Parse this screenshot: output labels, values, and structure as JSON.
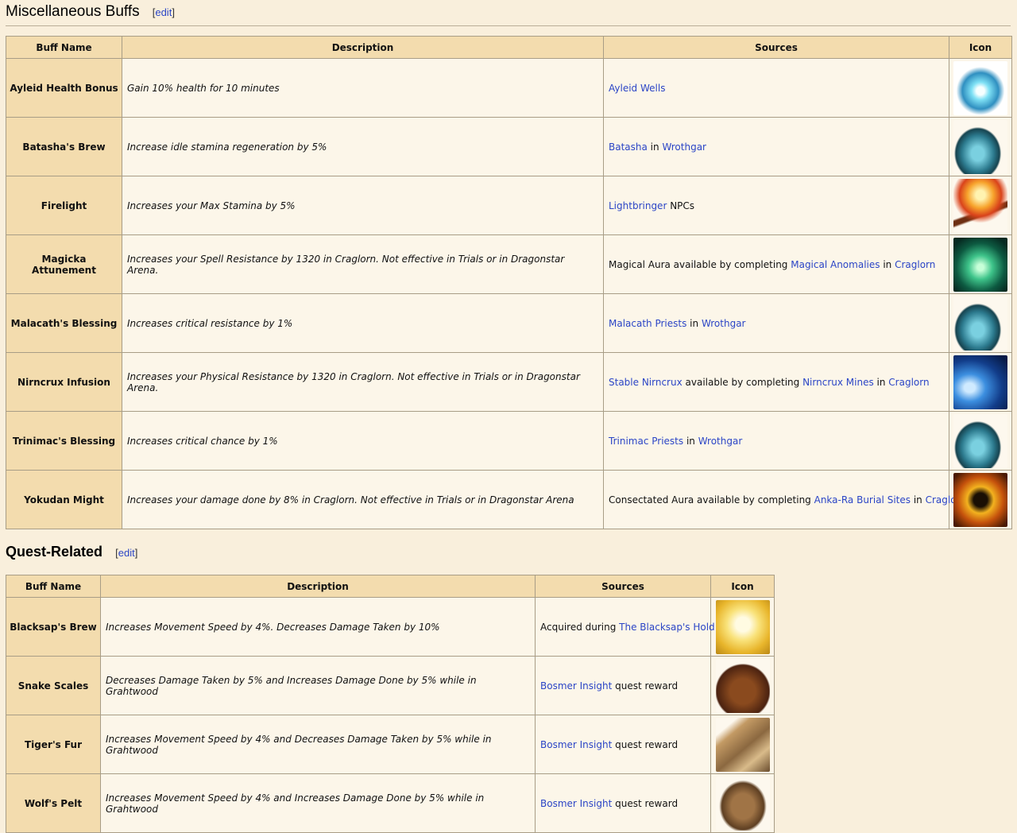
{
  "misc": {
    "title": "Miscellaneous Buffs",
    "edit": "edit",
    "headers": [
      "Buff Name",
      "Description",
      "Sources",
      "Icon"
    ],
    "rows": [
      {
        "name": "Ayleid Health Bonus",
        "desc": "Gain 10% health for 10 minutes",
        "sources": [
          {
            "text": "Ayleid Wells",
            "link": true
          }
        ],
        "icon": "blue-orb-icon"
      },
      {
        "name": "Batasha's Brew",
        "desc": "Increase idle stamina regeneration by 5%",
        "sources": [
          {
            "text": "Batasha",
            "link": true
          },
          {
            "text": " in ",
            "link": false
          },
          {
            "text": "Wrothgar",
            "link": true
          }
        ],
        "icon": "potion-jug-icon"
      },
      {
        "name": "Firelight",
        "desc": "Increases your Max Stamina by 5%",
        "sources": [
          {
            "text": "Lightbringer",
            "link": true
          },
          {
            "text": " NPCs",
            "link": false
          }
        ],
        "icon": "torch-icon"
      },
      {
        "name": "Magicka Attunement",
        "desc": "Increases your Spell Resistance by 1320 in Craglorn. Not effective in Trials or in Dragonstar Arena.",
        "sources": [
          {
            "text": "Magical Aura available by completing ",
            "link": false
          },
          {
            "text": "Magical Anomalies",
            "link": true
          },
          {
            "text": " in ",
            "link": false
          },
          {
            "text": "Craglorn",
            "link": true
          }
        ],
        "icon": "green-mage-icon"
      },
      {
        "name": "Malacath's Blessing",
        "desc": "Increases critical resistance by 1%",
        "sources": [
          {
            "text": "Malacath Priests",
            "link": true
          },
          {
            "text": " in ",
            "link": false
          },
          {
            "text": "Wrothgar",
            "link": true
          }
        ],
        "icon": "potion-jug-icon"
      },
      {
        "name": "Nirncrux Infusion",
        "desc": "Increases your Physical Resistance by 1320 in Craglorn. Not effective in Trials or in Dragonstar Arena.",
        "sources": [
          {
            "text": "Stable Nirncrux",
            "link": true
          },
          {
            "text": " available by completing ",
            "link": false
          },
          {
            "text": "Nirncrux Mines",
            "link": true
          },
          {
            "text": " in ",
            "link": false
          },
          {
            "text": "Craglorn",
            "link": true
          }
        ],
        "icon": "blue-wave-icon"
      },
      {
        "name": "Trinimac's Blessing",
        "desc": "Increases critical chance by 1%",
        "sources": [
          {
            "text": "Trinimac Priests",
            "link": true
          },
          {
            "text": " in ",
            "link": false
          },
          {
            "text": "Wrothgar",
            "link": true
          }
        ],
        "icon": "potion-jug-icon"
      },
      {
        "name": "Yokudan Might",
        "desc": "Increases your damage done by 8% in Craglorn. Not effective in Trials or in Dragonstar Arena",
        "sources": [
          {
            "text": "Consectated Aura available by completing ",
            "link": false
          },
          {
            "text": "Anka-Ra Burial Sites",
            "link": true
          },
          {
            "text": " in ",
            "link": false
          },
          {
            "text": "Craglorn",
            "link": true
          }
        ],
        "icon": "golden-burst-icon"
      }
    ]
  },
  "quest": {
    "title": "Quest-Related",
    "edit": "edit",
    "headers": [
      "Buff Name",
      "Description",
      "Sources",
      "Icon"
    ],
    "rows": [
      {
        "name": "Blacksap's Brew",
        "desc": "Increases Movement Speed by 4%. Decreases Damage Taken by 10%",
        "sources": [
          {
            "text": "Acquired during ",
            "link": false
          },
          {
            "text": "The Blacksap's Hold",
            "link": true
          }
        ],
        "icon": "praying-hands-icon"
      },
      {
        "name": "Snake Scales",
        "desc": "Decreases Damage Taken by 5% and Increases Damage Done by 5% while in Grahtwood",
        "sources": [
          {
            "text": "Bosmer Insight",
            "link": true
          },
          {
            "text": " quest reward",
            "link": false
          }
        ],
        "icon": "scales-icon"
      },
      {
        "name": "Tiger's Fur",
        "desc": "Increases Movement Speed by 4% and Decreases Damage Taken by 5% while in Grahtwood",
        "sources": [
          {
            "text": "Bosmer Insight",
            "link": true
          },
          {
            "text": " quest reward",
            "link": false
          }
        ],
        "icon": "fur-icon"
      },
      {
        "name": "Wolf's Pelt",
        "desc": "Increases Movement Speed by 4% and Increases Damage Done by 5% while in Grahtwood",
        "sources": [
          {
            "text": "Bosmer Insight",
            "link": true
          },
          {
            "text": " quest reward",
            "link": false
          }
        ],
        "icon": "pelt-icon"
      }
    ]
  }
}
